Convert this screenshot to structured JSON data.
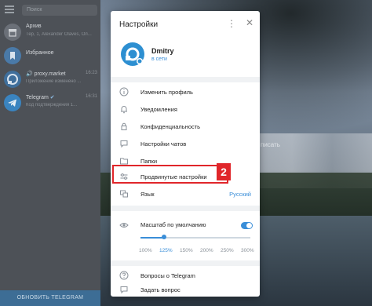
{
  "sidebar": {
    "search_placeholder": "Поиск",
    "chats": [
      {
        "name": "Архив",
        "sub": "Тер, 1, Alexander Olaves, Ол...",
        "time": ""
      },
      {
        "name": "Избранное",
        "sub": "",
        "time": ""
      },
      {
        "name": "proxy.market",
        "sub": "Приложение изменено ...",
        "time": "16:23"
      },
      {
        "name": "Telegram",
        "sub": "Код подтверждения 1...",
        "time": "16:31"
      }
    ],
    "update_button": "ОБНОВИТЬ TELEGRAM"
  },
  "background_text": "писать",
  "dialog": {
    "title": "Настройки",
    "profile": {
      "name": "Dmitry",
      "status": "в сети"
    },
    "items": [
      {
        "label": "Изменить профиль",
        "icon": "info-icon"
      },
      {
        "label": "Уведомления",
        "icon": "bell-icon"
      },
      {
        "label": "Конфиденциальность",
        "icon": "lock-icon"
      },
      {
        "label": "Настройки чатов",
        "icon": "chat-bubble-icon"
      },
      {
        "label": "Папки",
        "icon": "folder-icon"
      },
      {
        "label": "Продвинутые настройки",
        "icon": "sliders-icon"
      },
      {
        "label": "Язык",
        "icon": "language-icon",
        "value": "Русский"
      }
    ],
    "scale": {
      "label": "Масштаб по умолчанию",
      "enabled": true,
      "options": [
        "100%",
        "125%",
        "150%",
        "200%",
        "250%",
        "300%"
      ],
      "selected": "125%"
    },
    "bottom_items": [
      {
        "label": "Вопросы о Telegram",
        "icon": "help-icon"
      },
      {
        "label": "Задать вопрос",
        "icon": "question-chat-icon"
      }
    ]
  },
  "annotation": {
    "badge": "2",
    "color": "#e0262a"
  },
  "colors": {
    "accent": "#3a8ed8",
    "highlight": "#e0262a"
  }
}
